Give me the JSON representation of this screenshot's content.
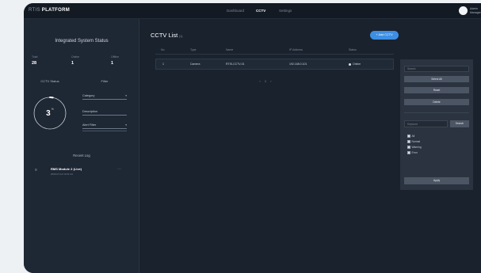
{
  "app": {
    "logo_prefix": "RTIS",
    "logo_name": "PLATFORM"
  },
  "nav": {
    "items": [
      {
        "label": "Dashboard",
        "active": false
      },
      {
        "label": "CCTV",
        "active": true
      },
      {
        "label": "Settings",
        "active": false
      }
    ]
  },
  "user": {
    "name": "Admin",
    "role": "Manager"
  },
  "sidebar": {
    "title": "Integrated System Status",
    "stats": [
      {
        "label": "Total",
        "value": "28"
      },
      {
        "label": "Online",
        "value": "1"
      },
      {
        "label": "Offline",
        "value": "1"
      }
    ],
    "gauge": {
      "heading": "CCTV Status",
      "value": 3,
      "value_text": "3",
      "unit": "%"
    },
    "filter": {
      "heading": "Filter",
      "category": "Category",
      "description": "Description",
      "alert": "Alert Filter",
      "caret": "▾"
    },
    "recent": {
      "title": "Recent Log",
      "items": [
        {
          "icon": "≡",
          "title": "RMS Module 2 (Live)",
          "time": "2023-07-12 10:21:44",
          "more": "⋯"
        }
      ]
    }
  },
  "main": {
    "title": "CCTV List",
    "count": "(1)",
    "add_button": "+ Add CCTV",
    "columns": [
      "No.",
      "Type",
      "Name",
      "IP Address",
      "Status"
    ],
    "rows": [
      {
        "no": "1",
        "type": "Camera",
        "name": "RTIS-CCTV-01",
        "ip": "192.168.0.101",
        "status": "Online"
      }
    ],
    "pagination": {
      "prev": "‹",
      "page": "1",
      "next": "›"
    }
  },
  "panel": {
    "input_placeholder": "Search",
    "buttons": [
      "Select All",
      "Reset",
      "Delete"
    ],
    "search_placeholder": "Keyword",
    "search_button": "Search",
    "checks": [
      {
        "label": "All",
        "checked": true
      },
      {
        "label": "Normal",
        "checked": true
      },
      {
        "label": "Warning",
        "checked": true
      },
      {
        "label": "Error",
        "checked": true
      }
    ],
    "apply_button": "Apply"
  },
  "colors": {
    "page_bg": "#eef1f4",
    "window_bg": "#1a222e",
    "sidebar_bg": "#1e2734",
    "panel_bg": "#2a333f",
    "accent": "#3d8fe3",
    "button_bg": "#4b5563",
    "status_online": "#d9dee5",
    "gauge_track": "#c8d0da",
    "gauge_fill": "#ffffff"
  },
  "icons": {
    "avatar": "user-avatar-icon",
    "log": "list-icon",
    "more": "more-icon",
    "caret": "chevron-down-icon"
  }
}
